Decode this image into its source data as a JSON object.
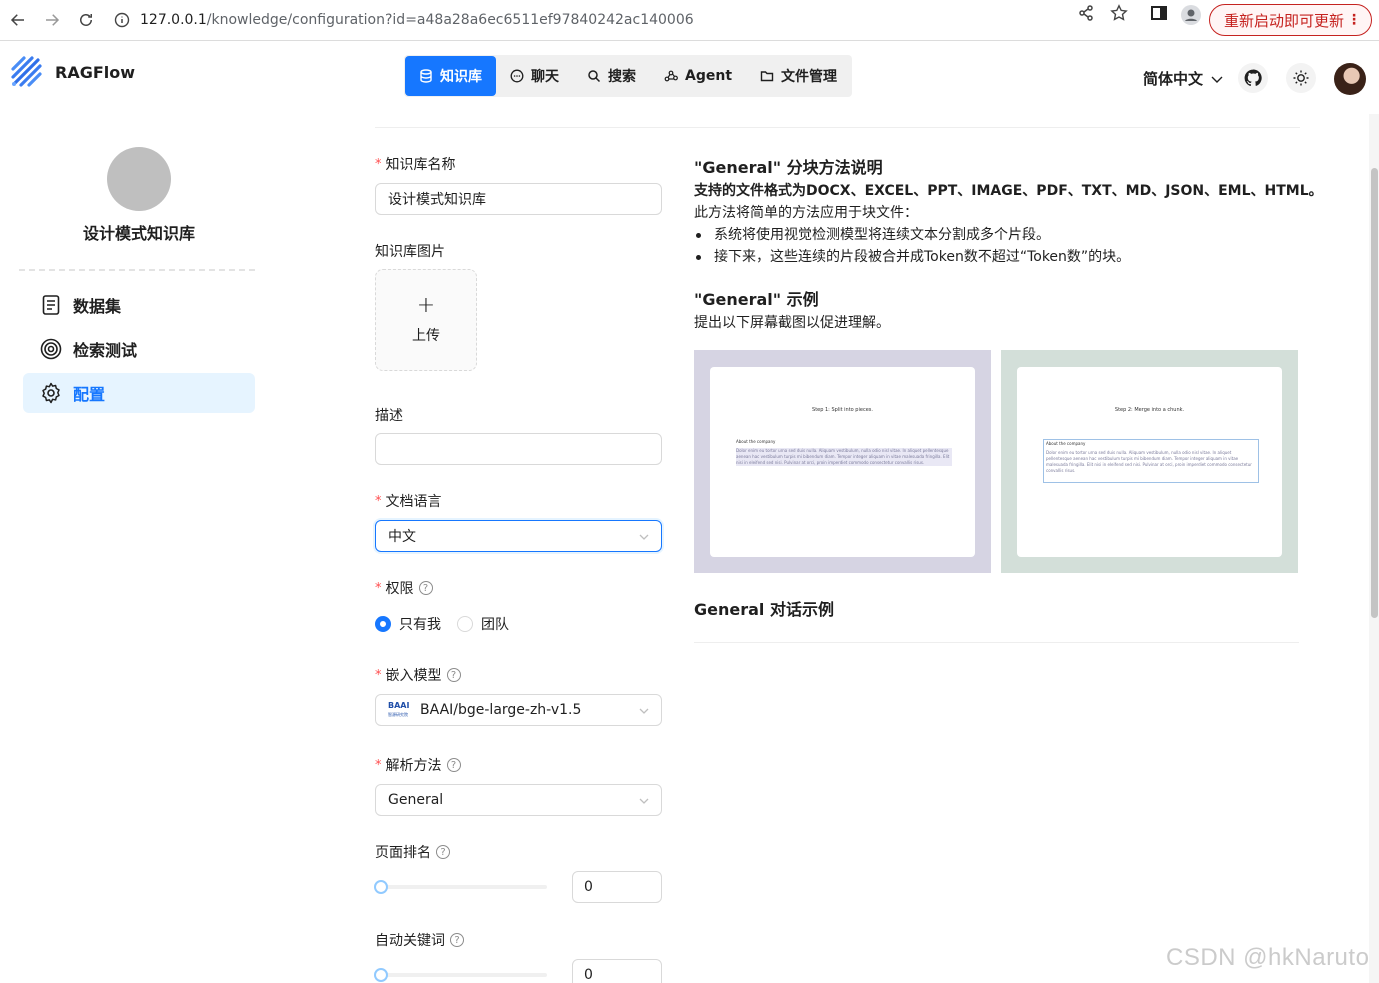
{
  "browser": {
    "url_host": "127.0.0.1",
    "url_path": "/knowledge/configuration?id=a48a28a6ec6511ef97840242ac140006",
    "update_button": "重新启动即可更新",
    "menu_glyph": "⋮"
  },
  "app": {
    "name": "RAGFlow",
    "nav": [
      {
        "label": "知识库",
        "icon": "database-icon",
        "active": true
      },
      {
        "label": "聊天",
        "icon": "chat-icon",
        "active": false
      },
      {
        "label": "搜索",
        "icon": "search-icon",
        "active": false
      },
      {
        "label": "Agent",
        "icon": "agent-graph-icon",
        "active": false
      },
      {
        "label": "文件管理",
        "icon": "folder-icon",
        "active": false
      }
    ],
    "language": "简体中文",
    "accent_color": "#1677ff"
  },
  "sidebar": {
    "kb_name": "设计模式知识库",
    "items": [
      {
        "label": "数据集",
        "icon": "document-icon",
        "active": false
      },
      {
        "label": "检索测试",
        "icon": "target-icon",
        "active": false
      },
      {
        "label": "配置",
        "icon": "gear-icon",
        "active": true
      }
    ]
  },
  "form": {
    "name_label": "知识库名称",
    "name_value": "设计模式知识库",
    "image_label": "知识库图片",
    "upload_label": "上传",
    "description_label": "描述",
    "description_value": "",
    "language_label": "文档语言",
    "language_value": "中文",
    "permission_label": "权限",
    "permission_options": [
      "只有我",
      "团队"
    ],
    "permission_selected": "只有我",
    "embedding_label": "嵌入模型",
    "embedding_value": "BAAI/bge-large-zh-v1.5",
    "embedding_logo_text": "BAAI",
    "embedding_logo_sub": "智源研究院",
    "parser_label": "解析方法",
    "parser_value": "General",
    "page_rank_label": "页面排名",
    "page_rank_value": "0",
    "auto_keywords_label": "自动关键词",
    "auto_keywords_value": "0"
  },
  "description": {
    "heading": "\"General\" 分块方法说明",
    "formats": "支持的文件格式为DOCX、EXCEL、PPT、IMAGE、PDF、TXT、MD、JSON、EML、HTML。",
    "intro": "此方法将简单的方法应用于块文件：",
    "bullets": [
      "系统将使用视觉检测模型将连续文本分割成多个片段。",
      "接下来，这些连续的片段被合并成Token数不超过“Token数”的块。"
    ],
    "example_heading": "\"General\" 示例",
    "example_text": "提出以下屏幕截图以促进理解。",
    "images": [
      {
        "step": "Step 1: Split into pieces.",
        "para_title": "About the company",
        "bg": "#d6d4e3"
      },
      {
        "step": "Step 2: Merge into a chunk.",
        "para_title": "About the company",
        "bg": "#d3dfd9"
      }
    ],
    "sample_text": "Dolor enim eu tortor urna sed duis nulla. Aliquam vestibulum, nulla odio nisl vitae. In aliquet pellentesque aenean hac vestibulum turpis mi bibendum diam. Tempor integer aliquam in vitae malesuada fringilla. Elit nisi in eleifend sed nisi. Pulvinar at orci, proin imperdiet commodo consectetur convallis risus.",
    "dialog_heading": "General 对话示例"
  },
  "watermark": "CSDN @hkNaruto"
}
